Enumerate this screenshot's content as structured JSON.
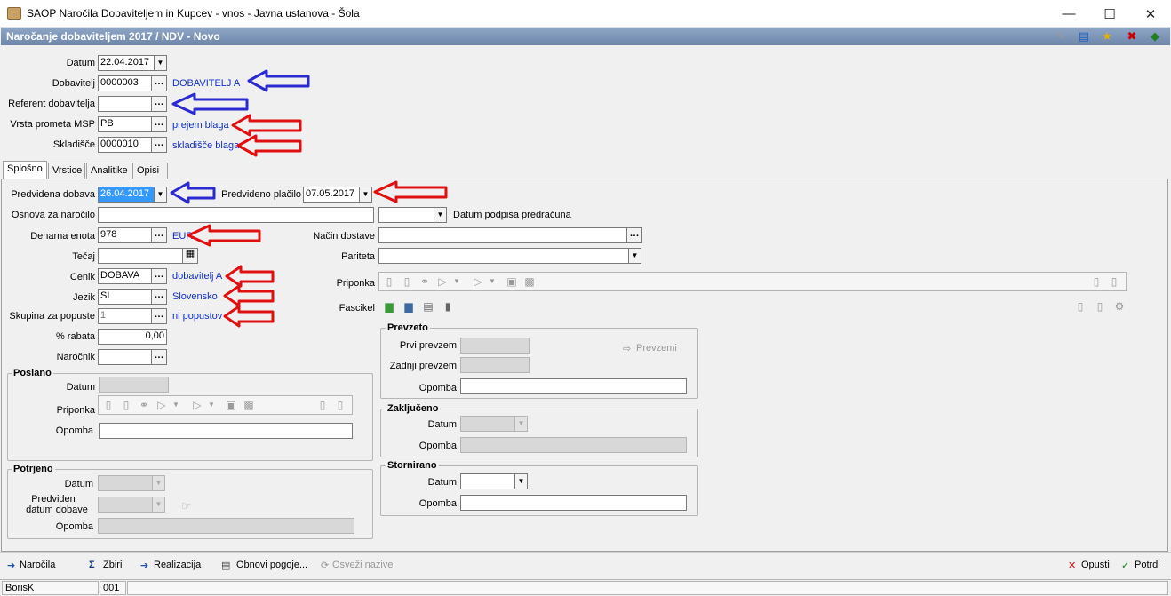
{
  "window": {
    "app_icon": "briefcase-icon",
    "title": "SAOP  Naročila Dobaviteljem in Kupcev - vnos - Javna ustanova - Šola",
    "minimize": "—",
    "maximize": "☐",
    "close": "✕"
  },
  "form": {
    "title": "Naročanje dobaviteljem 2017 / NDV - Novo"
  },
  "header": {
    "datum": {
      "label": "Datum",
      "value": "22.04.2017"
    },
    "dobavitelj": {
      "label": "Dobavitelj",
      "value": "0000003",
      "desc": "DOBAVITELJ  A"
    },
    "referent": {
      "label": "Referent dobavitelja",
      "value": ""
    },
    "vrsta": {
      "label": "Vrsta prometa MSP",
      "value": "PB",
      "desc": "prejem blaga"
    },
    "skladisce": {
      "label": "Skladišče",
      "value": "0000010",
      "desc": "skladišče blaga"
    }
  },
  "tabs": [
    "Splošno",
    "Vrstice",
    "Analitike",
    "Opisi"
  ],
  "general": {
    "predvidena_dobava": {
      "label": "Predvidena dobava",
      "value": "26.04.2017"
    },
    "predvideno_placilo": {
      "label": "Predvideno plačilo",
      "value": "07.05.2017"
    },
    "osnova": {
      "label": "Osnova za naročilo",
      "value": ""
    },
    "datum_podpisa": {
      "label": "Datum podpisa predračuna",
      "value": ""
    },
    "denarna": {
      "label": "Denarna enota",
      "value": "978",
      "desc": "EUR"
    },
    "nacin": {
      "label": "Način dostave",
      "value": ""
    },
    "tecaj": {
      "label": "Tečaj",
      "value": ""
    },
    "pariteta": {
      "label": "Pariteta",
      "value": ""
    },
    "cenik": {
      "label": "Cenik",
      "value": "DOBAVA",
      "desc": "dobavitelj A"
    },
    "priponka": {
      "label": "Priponka"
    },
    "jezik": {
      "label": "Jezik",
      "value": "SI",
      "desc": "Slovensko"
    },
    "fascikel": {
      "label": "Fascikel"
    },
    "skupina": {
      "label": "Skupina za popuste",
      "value": "1",
      "desc": "ni popustov"
    },
    "rabat": {
      "label": "% rabata",
      "value": "0,00"
    },
    "narocnik": {
      "label": "Naročnik",
      "value": ""
    }
  },
  "poslano": {
    "title": "Poslano",
    "datum": "Datum",
    "priponka": "Priponka",
    "opomba": "Opomba"
  },
  "potrjeno": {
    "title": "Potrjeno",
    "datum": "Datum",
    "predviden": "Predviden",
    "datum_dobave": "datum dobave",
    "opomba": "Opomba"
  },
  "prevzeto": {
    "title": "Prevzeto",
    "prvi": "Prvi prevzem",
    "zadnji": "Zadnji prevzem",
    "opomba": "Opomba",
    "prevzemi": "Prevzemi"
  },
  "zakljuceno": {
    "title": "Zaključeno",
    "datum": "Datum",
    "opomba": "Opomba"
  },
  "stornirano": {
    "title": "Stornirano",
    "datum": "Datum",
    "opomba": "Opomba"
  },
  "bottom": {
    "narocila": "Naročila",
    "zbiri": "Zbiri",
    "realizacija": "Realizacija",
    "obnovi": "Obnovi pogoje...",
    "osvezi": "Osveži nazive",
    "opusti": "Opusti",
    "potrdi": "Potrdi"
  },
  "status": {
    "user": "BorisK",
    "code": "001"
  },
  "colors": {
    "blue_arrow": "#2a2ad0",
    "red_arrow": "#e01010",
    "link": "#1030c8"
  }
}
